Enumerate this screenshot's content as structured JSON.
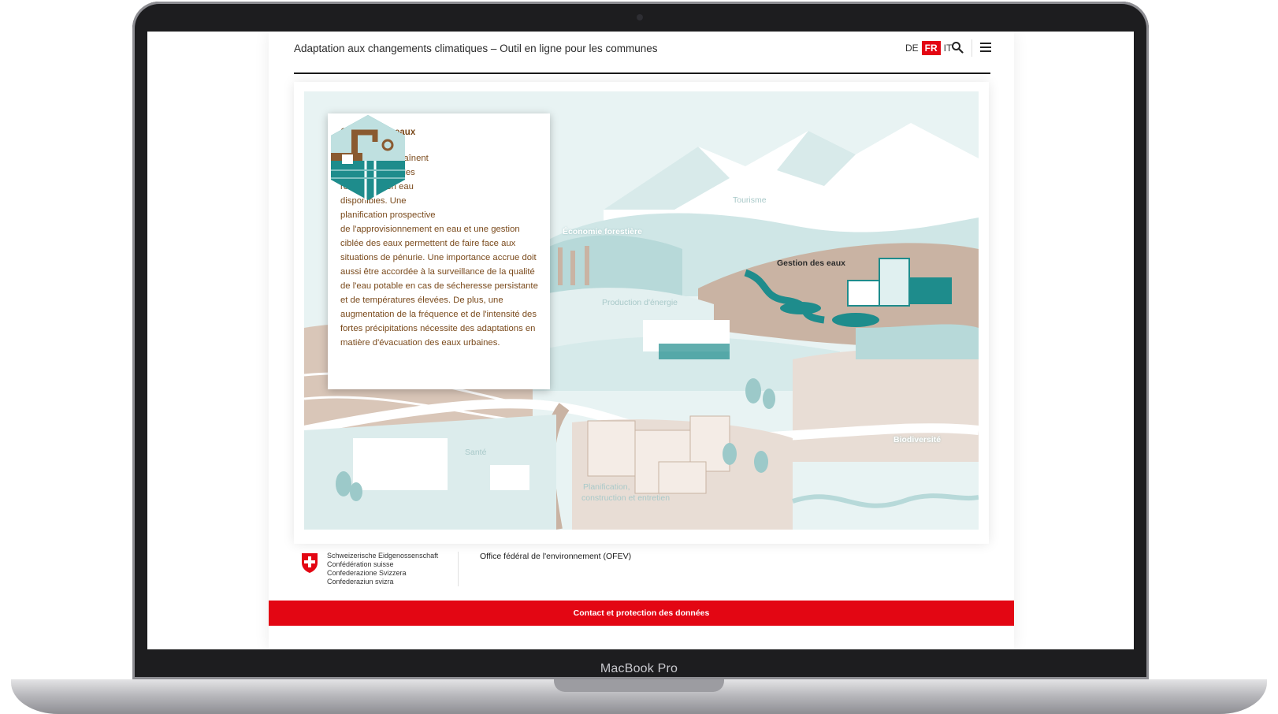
{
  "device": {
    "label": "MacBook Pro"
  },
  "header": {
    "title": "Adaptation aux changements climatiques – Outil en ligne pour les communes",
    "languages": [
      {
        "code": "DE",
        "active": false
      },
      {
        "code": "FR",
        "active": true
      },
      {
        "code": "IT",
        "active": false
      }
    ],
    "icons": [
      "search-icon",
      "menu-icon"
    ]
  },
  "illustration": {
    "labels": {
      "tourisme": "Tourisme",
      "foret": "Économie forestière",
      "eaux": "Gestion des eaux",
      "energie": "Production d'énergie",
      "sante": "Santé",
      "biodiversite": "Biodiversité",
      "planification_1": "Planification,",
      "planification_2": "construction et entretien"
    }
  },
  "popup": {
    "title": "Gestion des eaux",
    "text_narrow": "Les périodes de sécheresse entraînent une diminution des ressources en eau disponibles. Une planification prospective",
    "text_wide": "de l'approvisionnement en eau et une gestion ciblée des eaux permettent de faire face aux situations de pénurie. Une importance accrue doit aussi être accordée à la surveillance de la qualité de l'eau potable en cas de sécheresse persistante et de températures élevées. De plus, une augmentation de la fréquence et de l'intensité des fortes précipitations nécessite des adaptations en matière d'évacuation des eaux urbaines.",
    "icon": "water-tap-hexagon-icon"
  },
  "footer": {
    "confederation": [
      "Schweizerische Eidgenossenschaft",
      "Confédération suisse",
      "Confederazione Svizzera",
      "Confederaziun svizra"
    ],
    "office": "Office fédéral de l'environnement (OFEV)",
    "contact_link": "Contact et protection des données"
  },
  "colors": {
    "accent_red": "#e30613",
    "popup_text": "#7a4a1c",
    "teal": "#1e8c8c",
    "pale_teal": "#cfe6e6",
    "sand": "#c9b3a3"
  }
}
